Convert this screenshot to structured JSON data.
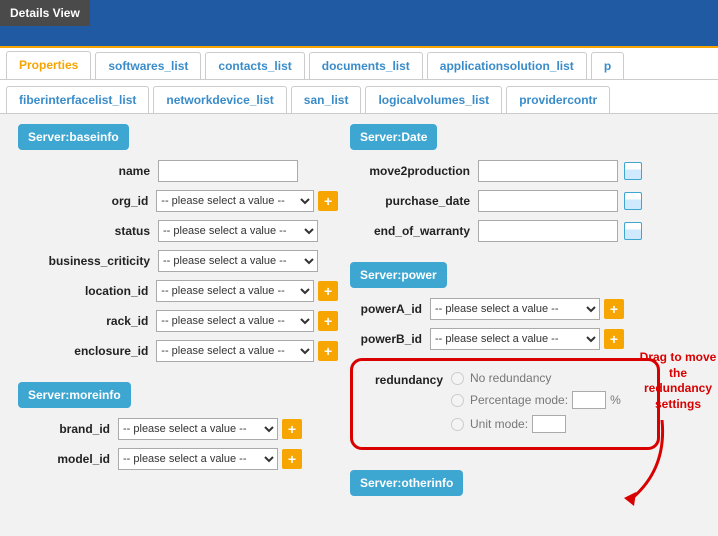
{
  "header": {
    "details_view": "Details View"
  },
  "tabs_row1": [
    "Properties",
    "softwares_list",
    "contacts_list",
    "documents_list",
    "applicationsolution_list",
    "p"
  ],
  "tabs_row2": [
    "fiberinterfacelist_list",
    "networkdevice_list",
    "san_list",
    "logicalvolumes_list",
    "providercontr"
  ],
  "placeholder": "-- please select a value --",
  "groups": {
    "baseinfo": {
      "title": "Server:baseinfo",
      "fields": {
        "name": "name",
        "org_id": "org_id",
        "status": "status",
        "business_criticity": "business_criticity",
        "location_id": "location_id",
        "rack_id": "rack_id",
        "enclosure_id": "enclosure_id"
      }
    },
    "moreinfo": {
      "title": "Server:moreinfo",
      "fields": {
        "brand_id": "brand_id",
        "model_id": "model_id"
      }
    },
    "date": {
      "title": "Server:Date",
      "fields": {
        "move2production": "move2production",
        "purchase_date": "purchase_date",
        "end_of_warranty": "end_of_warranty"
      }
    },
    "power": {
      "title": "Server:power",
      "fields": {
        "powerA_id": "powerA_id",
        "powerB_id": "powerB_id",
        "redundancy": "redundancy"
      },
      "redundancy_options": {
        "none": "No redundancy",
        "percent": "Percentage mode:",
        "unit": "Unit mode:",
        "percent_suffix": "%"
      }
    },
    "otherinfo": {
      "title": "Server:otherinfo"
    }
  },
  "annotation": "Drag to move the redundancy settings"
}
